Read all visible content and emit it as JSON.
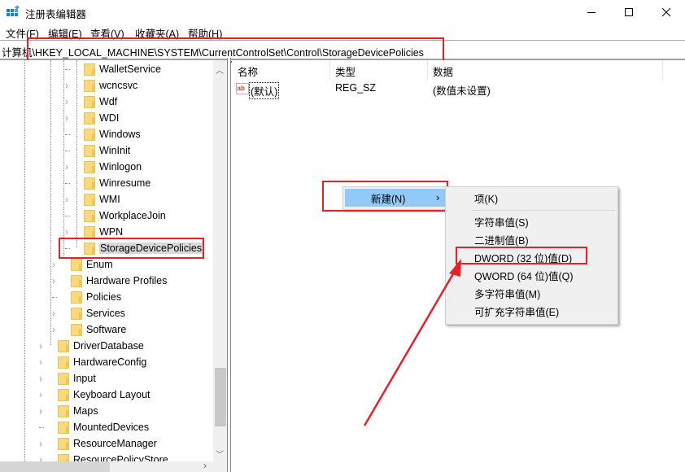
{
  "window": {
    "title": "注册表编辑器",
    "icon": "regedit-icon",
    "controls": {
      "minimize": "minimize-icon",
      "maximize": "maximize-icon",
      "close": "close-icon"
    }
  },
  "menubar": {
    "items": [
      {
        "label": "文件(F)"
      },
      {
        "label": "编辑(E)"
      },
      {
        "label": "查看(V)"
      },
      {
        "label": "收藏夹(A)"
      },
      {
        "label": "帮助(H)"
      }
    ]
  },
  "address": {
    "path": "计算机\\HKEY_LOCAL_MACHINE\\SYSTEM\\CurrentControlSet\\Control\\StorageDevicePolicies"
  },
  "tree": {
    "items": [
      {
        "label": "WalletService",
        "level": 2,
        "expandable": false
      },
      {
        "label": "wcncsvc",
        "level": 2,
        "expandable": true
      },
      {
        "label": "Wdf",
        "level": 2,
        "expandable": true
      },
      {
        "label": "WDI",
        "level": 2,
        "expandable": true
      },
      {
        "label": "Windows",
        "level": 2,
        "expandable": false
      },
      {
        "label": "WinInit",
        "level": 2,
        "expandable": false
      },
      {
        "label": "Winlogon",
        "level": 2,
        "expandable": true
      },
      {
        "label": "Winresume",
        "level": 2,
        "expandable": false
      },
      {
        "label": "WMI",
        "level": 2,
        "expandable": true
      },
      {
        "label": "WorkplaceJoin",
        "level": 2,
        "expandable": false
      },
      {
        "label": "WPN",
        "level": 2,
        "expandable": true
      },
      {
        "label": "StorageDevicePolicies",
        "level": 2,
        "expandable": false,
        "selected": true
      },
      {
        "label": "Enum",
        "level": 1,
        "expandable": true
      },
      {
        "label": "Hardware Profiles",
        "level": 1,
        "expandable": true
      },
      {
        "label": "Policies",
        "level": 1,
        "expandable": false
      },
      {
        "label": "Services",
        "level": 1,
        "expandable": true
      },
      {
        "label": "Software",
        "level": 1,
        "expandable": true
      },
      {
        "label": "DriverDatabase",
        "level": 0,
        "expandable": true
      },
      {
        "label": "HardwareConfig",
        "level": 0,
        "expandable": true
      },
      {
        "label": "Input",
        "level": 0,
        "expandable": true
      },
      {
        "label": "Keyboard Layout",
        "level": 0,
        "expandable": true
      },
      {
        "label": "Maps",
        "level": 0,
        "expandable": true
      },
      {
        "label": "MountedDevices",
        "level": 0,
        "expandable": false
      },
      {
        "label": "ResourceManager",
        "level": 0,
        "expandable": true
      },
      {
        "label": "ResourcePolicyStore",
        "level": 0,
        "expandable": true
      }
    ]
  },
  "values_pane": {
    "columns": [
      {
        "label": "名称"
      },
      {
        "label": "类型"
      },
      {
        "label": "数据"
      }
    ],
    "rows": [
      {
        "name": "(默认)",
        "type": "REG_SZ",
        "data": "(数值未设置)",
        "icon": "string-value-icon"
      }
    ]
  },
  "context_menu": {
    "new_item": {
      "label": "新建(N)",
      "arrow": "›"
    },
    "submenu": [
      {
        "label": "项(K)"
      },
      {
        "label": "字符串值(S)"
      },
      {
        "label": "二进制值(B)"
      },
      {
        "label": "DWORD (32 位)值(D)",
        "highlighted_annotation": true
      },
      {
        "label": "QWORD (64 位)值(Q)"
      },
      {
        "label": "多字符串值(M)"
      },
      {
        "label": "可扩充字符串值(E)"
      }
    ]
  },
  "annotation_color": "#e8202a",
  "menu_highlight_color": "#91c9f7"
}
